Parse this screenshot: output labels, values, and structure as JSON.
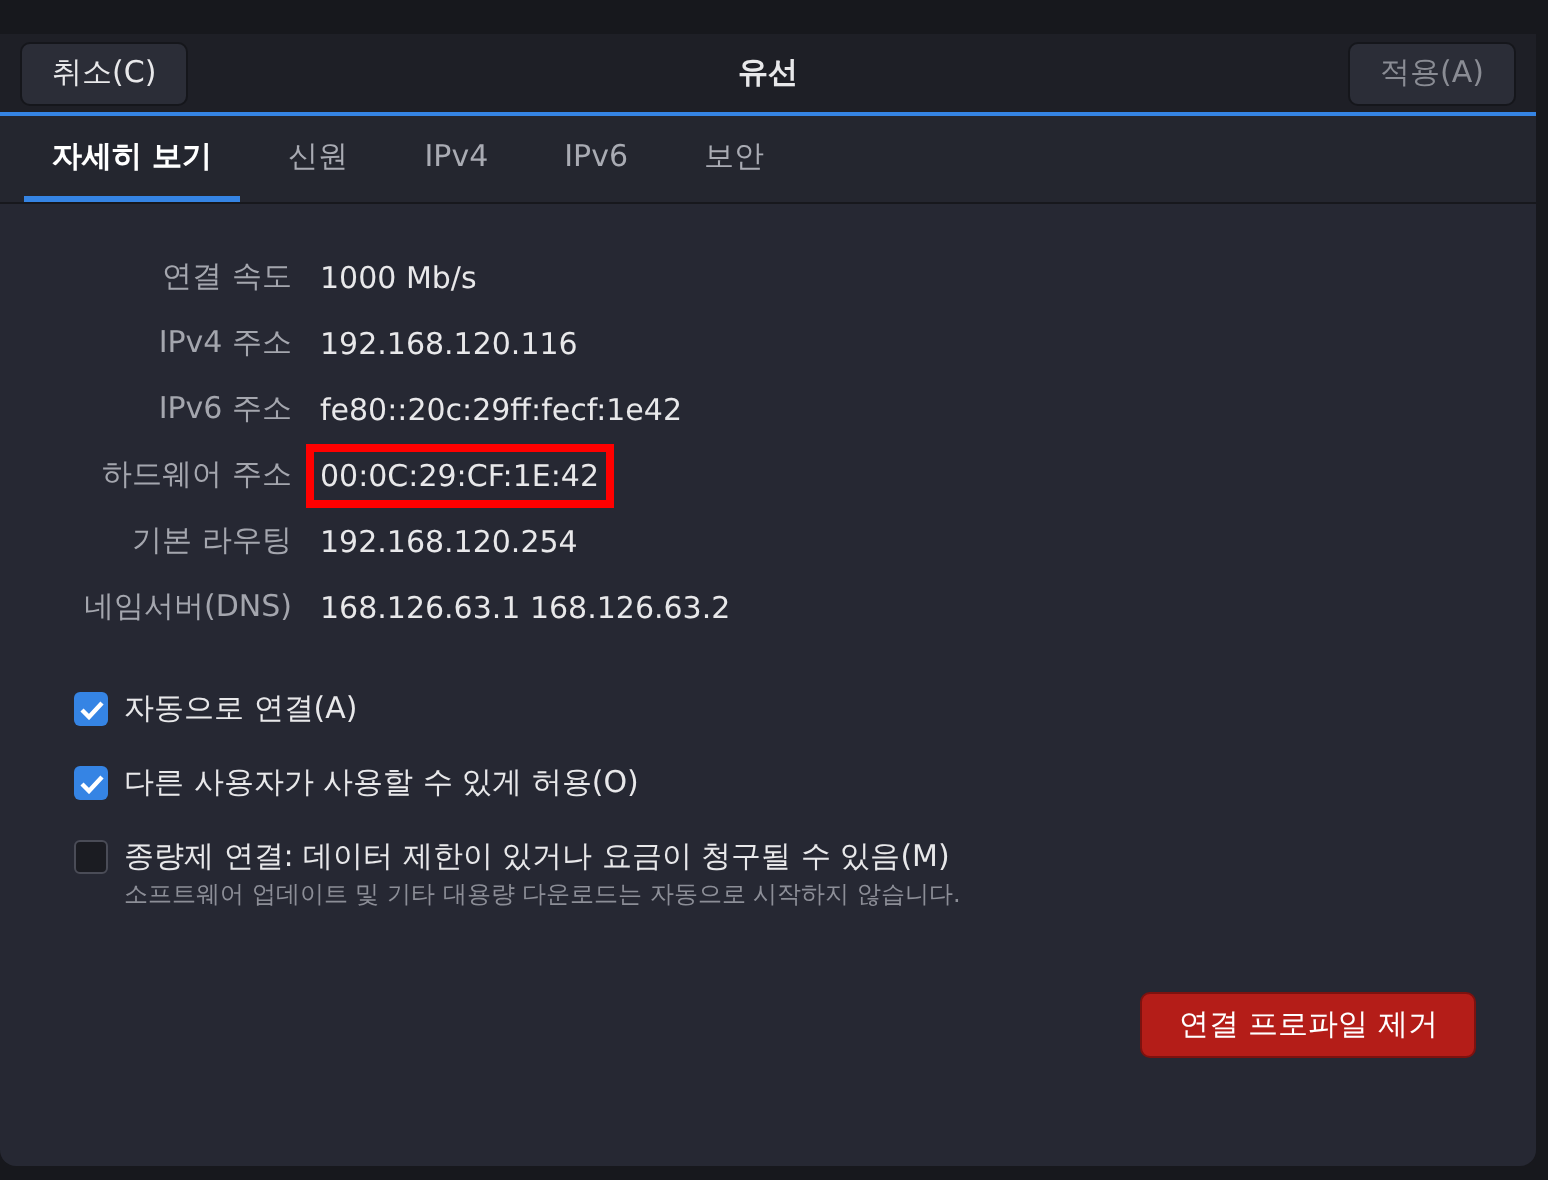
{
  "header": {
    "cancel_button": "취소(C)",
    "title": "유선",
    "apply_button": "적용(A)",
    "apply_disabled": true
  },
  "tabs": [
    {
      "label": "자세히 보기",
      "selected": true
    },
    {
      "label": "신원",
      "selected": false
    },
    {
      "label": "IPv4",
      "selected": false
    },
    {
      "label": "IPv6",
      "selected": false
    },
    {
      "label": "보안",
      "selected": false
    }
  ],
  "details": [
    {
      "label": "연결 속도",
      "value": "1000 Mb/s",
      "highlighted": false
    },
    {
      "label": "IPv4 주소",
      "value": "192.168.120.116",
      "highlighted": false
    },
    {
      "label": "IPv6 주소",
      "value": "fe80::20c:29ff:fecf:1e42",
      "highlighted": false
    },
    {
      "label": "하드웨어 주소",
      "value": "00:0C:29:CF:1E:42",
      "highlighted": true
    },
    {
      "label": "기본 라우팅",
      "value": "192.168.120.254",
      "highlighted": false
    },
    {
      "label": "네임서버(DNS)",
      "value": "168.126.63.1 168.126.63.2",
      "highlighted": false
    }
  ],
  "options": [
    {
      "label": "자동으로 연결(A)",
      "checked": true
    },
    {
      "label": "다른 사용자가 사용할 수 있게 허용(O)",
      "checked": true
    },
    {
      "label": "종량제 연결: 데이터 제한이 있거나 요금이 청구될 수 있음(M)",
      "hint": "소프트웨어 업데이트 및 기타 대용량 다운로드는 자동으로 시작하지 않습니다.",
      "checked": false
    }
  ],
  "remove_button": "연결 프로파일 제거"
}
